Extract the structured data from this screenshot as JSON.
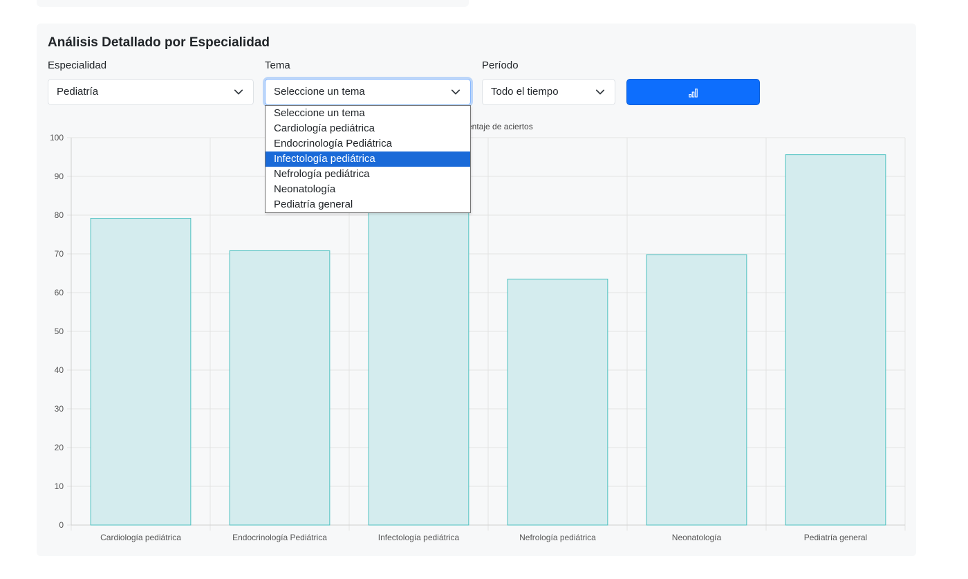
{
  "panel": {
    "title": "Análisis Detallado por Especialidad"
  },
  "filters": {
    "especialidad": {
      "label": "Especialidad",
      "value": "Pediatría"
    },
    "tema": {
      "label": "Tema",
      "value": "Seleccione un tema",
      "options": [
        "Seleccione un tema",
        "Cardiología pediátrica",
        "Endocrinología Pediátrica",
        "Infectología pediátrica",
        "Nefrología pediátrica",
        "Neonatología",
        "Pediatría general"
      ],
      "highlighted_option": "Infectología pediátrica"
    },
    "periodo": {
      "label": "Período",
      "value": "Todo el tiempo"
    },
    "chart_button_icon": "bar-chart-icon"
  },
  "chart_data": {
    "type": "bar",
    "legend_label_visible": "entaje de aciertos",
    "categories": [
      "Cardiología pediátrica",
      "Endocrinología Pediátrica",
      "Infectología pediátrica",
      "Nefrología pediátrica",
      "Neonatología",
      "Pediatría general"
    ],
    "series": [
      {
        "values": [
          79.2,
          70.8,
          83.3,
          63.5,
          69.8,
          95.6
        ]
      }
    ],
    "ylim": [
      0,
      100
    ],
    "yticks": [
      0,
      10,
      20,
      30,
      40,
      50,
      60,
      70,
      80,
      90,
      100
    ],
    "grid": true,
    "bar_fill": "#d4ecee",
    "bar_stroke": "#4bc0c0"
  }
}
